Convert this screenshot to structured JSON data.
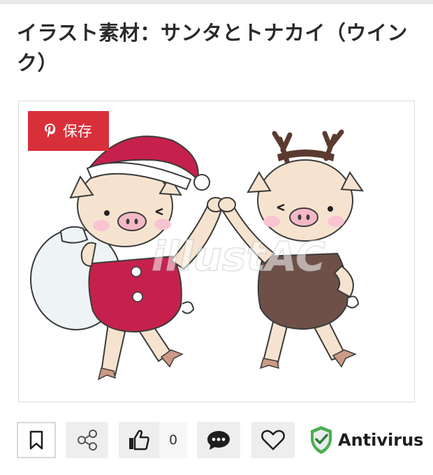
{
  "page": {
    "title": "イラスト素材：サンタとトナカイ（ウインク）"
  },
  "image": {
    "watermark": "illustAC",
    "alt_subject": "santa-and-reindeer-pigs"
  },
  "pin_button": {
    "label": "保存",
    "icon": "pinterest-icon",
    "color": "#d8303a"
  },
  "actions": {
    "bookmark_icon": "bookmark-icon",
    "share_icon": "share-icon",
    "like_icon": "thumbs-up-icon",
    "like_count": "0",
    "comment_icon": "comment-icon",
    "favorite_icon": "heart-icon"
  },
  "antivirus": {
    "label": "Antivirus",
    "icon": "shield-check-icon",
    "color": "#4caf50"
  }
}
